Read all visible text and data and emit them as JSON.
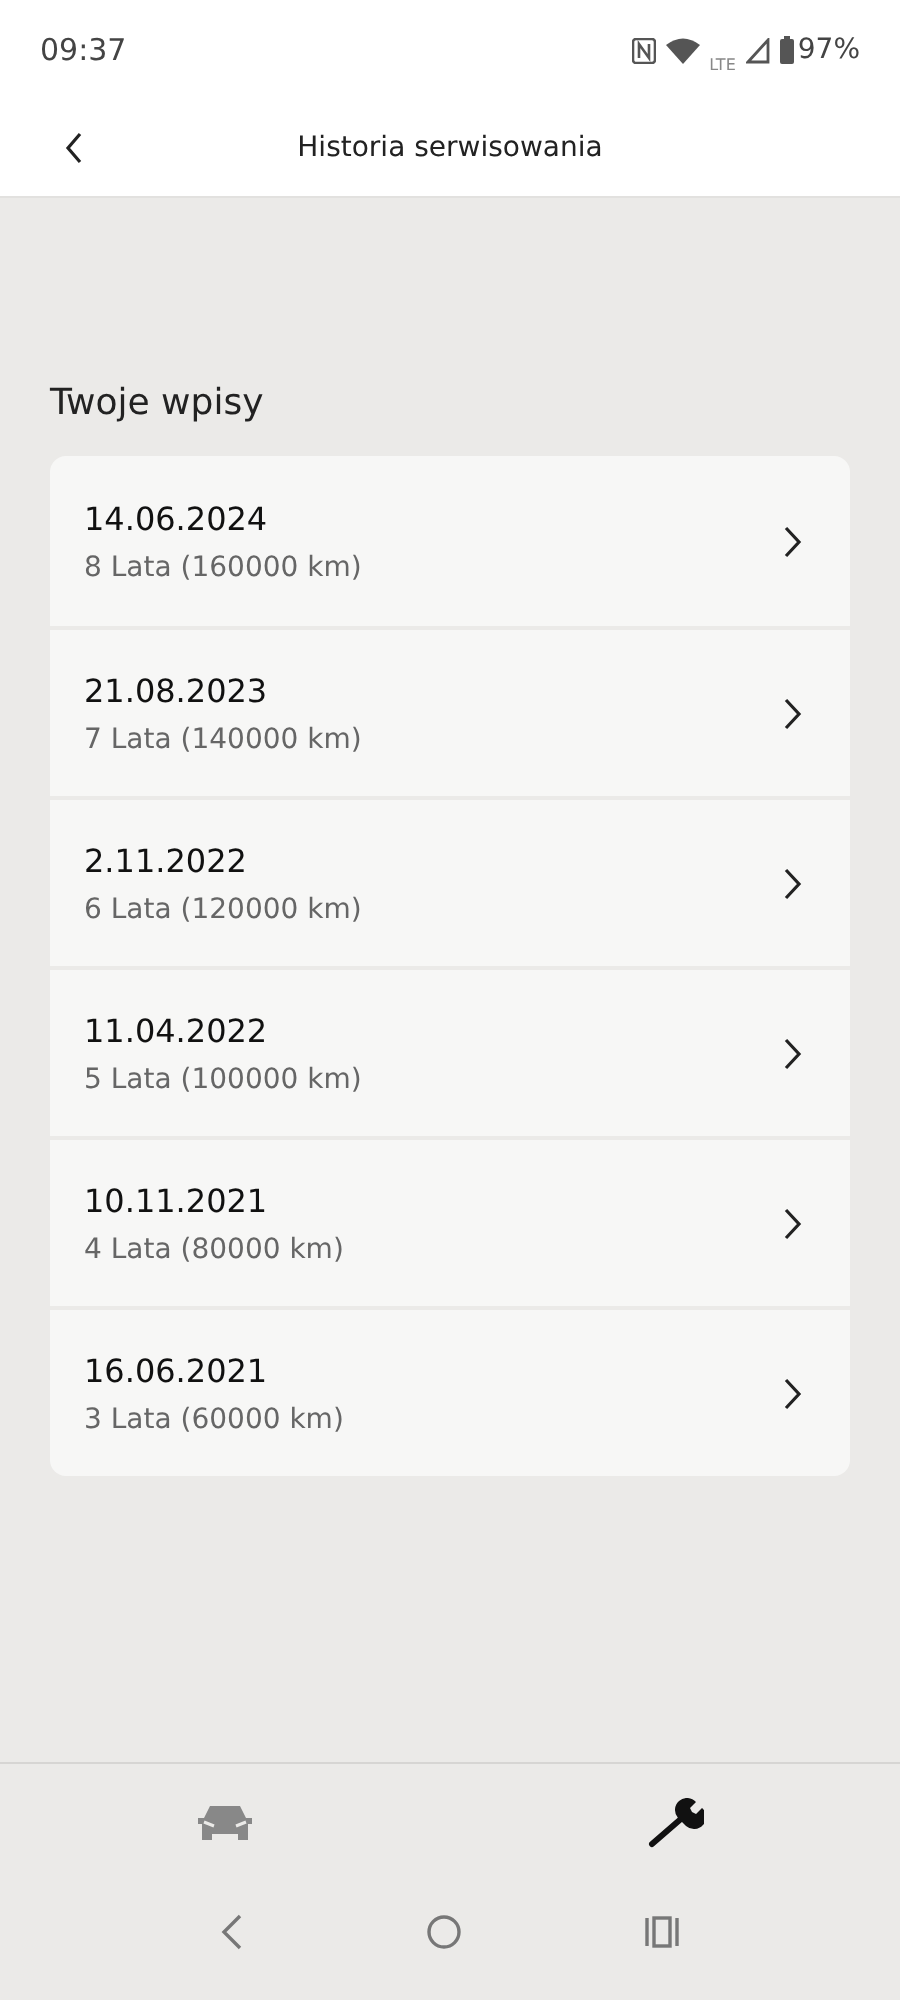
{
  "status_bar": {
    "time": "09:37",
    "lte": "LTE",
    "battery": "97%"
  },
  "header": {
    "title": "Historia serwisowania"
  },
  "section_title": "Twoje wpisy",
  "entries": [
    {
      "date": "14.06.2024",
      "detail": "8 Lata (160000 km)"
    },
    {
      "date": "21.08.2023",
      "detail": "7 Lata (140000 km)"
    },
    {
      "date": "2.11.2022",
      "detail": "6 Lata (120000 km)"
    },
    {
      "date": "11.04.2022",
      "detail": "5 Lata (100000 km)"
    },
    {
      "date": "10.11.2021",
      "detail": "4 Lata (80000 km)"
    },
    {
      "date": "16.06.2021",
      "detail": "3 Lata (60000 km)"
    }
  ],
  "bottom_tabs": [
    {
      "kind": "car",
      "selected": false
    },
    {
      "kind": "wrench",
      "selected": true
    }
  ]
}
